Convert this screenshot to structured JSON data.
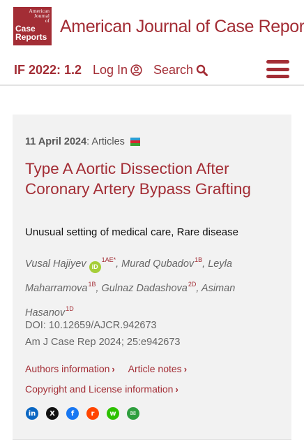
{
  "header": {
    "logo": {
      "line1": "American",
      "line2": "Journal",
      "line3": "of",
      "line4": "Case",
      "line5": "Reports"
    },
    "site_title": "American Journal of Case Reports"
  },
  "nav": {
    "impact_factor": "IF 2022: 1.2",
    "login": "Log In",
    "search": "Search",
    "icons": {
      "login": "user-circle-icon",
      "search": "magnifier-icon",
      "menu": "hamburger-menu-icon"
    }
  },
  "article": {
    "date": "11 April 2024",
    "section": ": Articles",
    "flag": "azerbaijan-flag-icon",
    "title": "Type A Aortic Dissection After Coronary Artery Bypass Grafting",
    "subtitle": "Unusual setting of medical care, Rare disease",
    "authors": [
      {
        "name": "Vusal Hajiyev",
        "orcid": "iD",
        "sup": "1AE*"
      },
      {
        "name": "Murad Qubadov",
        "sup": "1B"
      },
      {
        "name": "Leyla Maharramova",
        "sup": "1B"
      },
      {
        "name": "Gulnaz Dadashova",
        "sup": "2D"
      },
      {
        "name": "Asiman Hasanov",
        "sup": "1D"
      }
    ],
    "doi": "DOI: 10.12659/AJCR.942673",
    "citation": "Am J Case Rep 2024; 25:e942673",
    "links": {
      "authors_info": "Authors information",
      "article_notes": "Article notes",
      "copyright": "Copyright and License information"
    },
    "share": [
      {
        "name": "linkedin-icon",
        "color": "#0a66c2",
        "glyph": "in"
      },
      {
        "name": "x-icon",
        "color": "#111111",
        "glyph": "X"
      },
      {
        "name": "facebook-icon",
        "color": "#1877f2",
        "glyph": "f"
      },
      {
        "name": "reddit-icon",
        "color": "#ff4500",
        "glyph": "r"
      },
      {
        "name": "wechat-icon",
        "color": "#2dc100",
        "glyph": "w"
      },
      {
        "name": "email-icon",
        "color": "#2e9e3e",
        "glyph": "✉"
      }
    ]
  },
  "colors": {
    "brand": "#a32d35",
    "card_bg": "#f2f2f2",
    "orcid": "#a6ce39"
  }
}
